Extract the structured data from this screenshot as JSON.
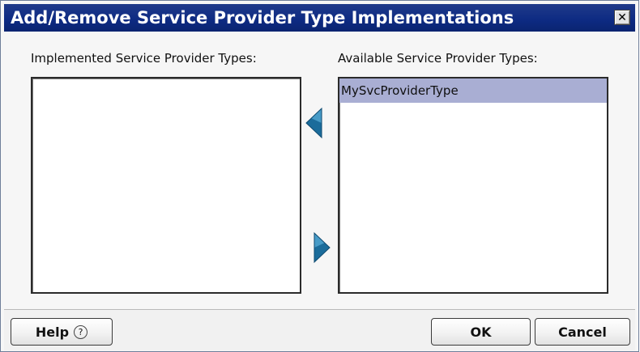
{
  "window": {
    "title": "Add/Remove Service Provider Type Implementations",
    "close_glyph": "✕"
  },
  "implemented": {
    "label": "Implemented Service Provider Types:",
    "items": []
  },
  "available": {
    "label": "Available Service Provider Types:",
    "items": [
      {
        "label": "MySvcProviderType",
        "selected": true
      }
    ]
  },
  "buttons": {
    "help_label": "Help",
    "help_icon_glyph": "?",
    "ok_label": "OK",
    "cancel_label": "Cancel"
  },
  "icons": {
    "move_left": "arrow-left-icon",
    "move_right": "arrow-right-icon",
    "close": "close-icon",
    "help": "help-icon"
  },
  "colors": {
    "titlebar": "#0d2a82",
    "selection": "#a9aed3",
    "arrow": "#1b6c9b"
  }
}
